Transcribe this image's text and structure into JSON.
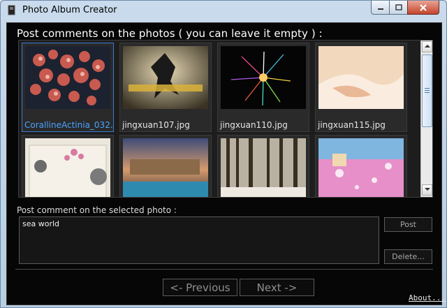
{
  "window": {
    "title": "Photo Album Creator",
    "controls": {
      "minimize": "minimize-icon",
      "maximize": "maximize-icon",
      "close": "close-icon"
    }
  },
  "main": {
    "heading": "Post comments on the photos ( you can leave it empty ) :",
    "photos": [
      {
        "filename": "CorallineActinia_032.",
        "selected": true
      },
      {
        "filename": "jingxuan107.jpg",
        "selected": false
      },
      {
        "filename": "jingxuan110.jpg",
        "selected": false
      },
      {
        "filename": "jingxuan115.jpg",
        "selected": false
      },
      {
        "filename": "",
        "selected": false
      },
      {
        "filename": "",
        "selected": false
      },
      {
        "filename": "",
        "selected": false
      },
      {
        "filename": "",
        "selected": false
      }
    ]
  },
  "comment": {
    "label": "Post comment on the selected photo :",
    "value": "sea world",
    "post_label": "Post",
    "delete_label": "Delete..."
  },
  "footer": {
    "previous_label": "<- Previous",
    "next_label": "Next ->",
    "about_label": "About..."
  },
  "colors": {
    "background": "#060606",
    "selection": "#3d7bd6",
    "selected_caption": "#4aa3ff",
    "button_text": "#8f8f8f"
  }
}
